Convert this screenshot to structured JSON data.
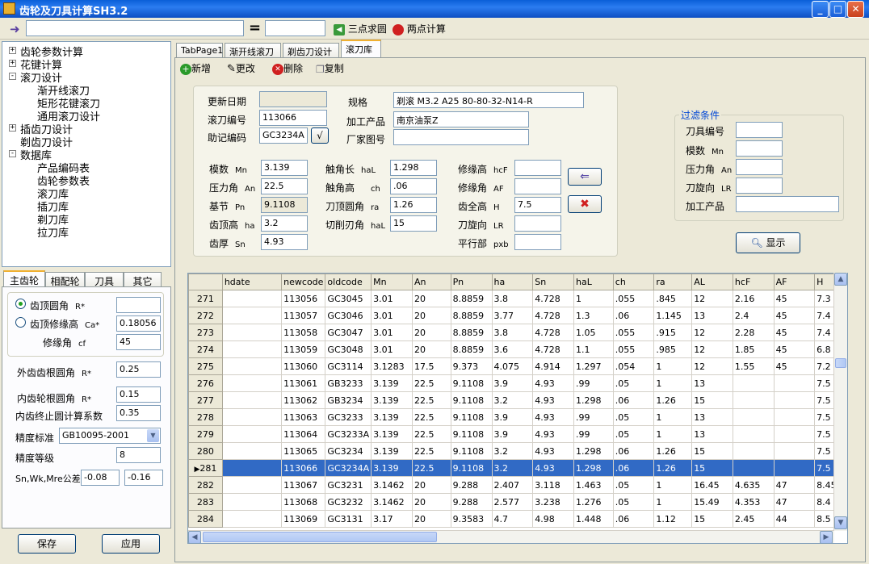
{
  "window": {
    "title": "齿轮及刀具计算SH3.2",
    "minimize": "_",
    "maximize": "□",
    "close": "✕"
  },
  "toolbar": {
    "equals": "=",
    "three_point": "三点求圆",
    "two_point": "两点计算"
  },
  "tree": {
    "items": [
      {
        "label": "齿轮参数计算",
        "expander": "+"
      },
      {
        "label": "花键计算",
        "expander": "+"
      },
      {
        "label": "滚刀设计",
        "expander": "-"
      },
      {
        "label": "渐开线滚刀"
      },
      {
        "label": "矩形花键滚刀"
      },
      {
        "label": "通用滚刀设计"
      },
      {
        "label": "插齿刀设计",
        "expander": "+"
      },
      {
        "label": "剃齿刀设计"
      },
      {
        "label": "数据库",
        "expander": "-"
      },
      {
        "label": "产品编码表"
      },
      {
        "label": "齿轮参数表"
      },
      {
        "label": "滚刀库"
      },
      {
        "label": "插刀库"
      },
      {
        "label": "剃刀库"
      },
      {
        "label": "拉刀库"
      }
    ]
  },
  "left_tabs": [
    "主齿轮",
    "相配轮",
    "刀具",
    "其它"
  ],
  "left_panel": {
    "tip_radius_label": "齿顶圆角",
    "tip_radius_sym": "R*",
    "tip_radius_value": "",
    "tip_mod_label": "齿顶修缘高",
    "tip_mod_sym": "Ca*",
    "tip_mod_value": "0.18056",
    "mod_angle_label": "修缘角",
    "mod_angle_sym": "cf",
    "mod_angle_value": "45",
    "ext_root_label": "外齿齿根圆角",
    "ext_root_sym": "R*",
    "ext_root_value": "0.25",
    "int_root_label": "内齿轮根圆角",
    "int_root_sym": "R*",
    "int_root_value": "0.15",
    "int_stop_label": "内齿终止圆计算系数",
    "int_stop_value": "0.35",
    "precision_std_label": "精度标准",
    "precision_std_value": "GB10095-2001",
    "precision_grade_label": "精度等级",
    "precision_grade_value": "8",
    "tolerance_label": "Sn,Wk,Mre公差",
    "tol_upper": "-0.08",
    "tol_lower": "-0.16",
    "save": "保存",
    "apply": "应用"
  },
  "main_tabs": [
    "TabPage1",
    "渐开线滚刀",
    "剃齿刀设计",
    "滚刀库"
  ],
  "actions": {
    "add": "新增",
    "edit": "更改",
    "delete": "删除",
    "copy": "复制"
  },
  "form": {
    "update_date_label": "更新日期",
    "update_date": "",
    "hob_code_label": "滚刀编号",
    "hob_code": "113066",
    "mnemonic_label": "助记编码",
    "mnemonic": "GC3234A",
    "check_btn": "√",
    "spec_label": "规格",
    "spec": "剃滚 M3.2 A25 80-80-32-N14-R",
    "product_label": "加工产品",
    "product": "南京油泵Z",
    "factory_label": "厂家图号",
    "factory": "",
    "module_label": "模数",
    "module_sym": "Mn",
    "module": "3.139",
    "pressure_label": "压力角",
    "pressure_sym": "An",
    "pressure": "22.5",
    "pitch_label": "基节",
    "pitch_sym": "Pn",
    "pitch": "9.1108",
    "addendum_label": "齿顶高",
    "addendum_sym": "ha",
    "addendum": "3.2",
    "thickness_label": "齿厚",
    "thickness_sym": "Sn",
    "thickness": "4.93",
    "touch_len_label": "触角长",
    "touch_len_sym": "haL",
    "touch_len": "1.298",
    "touch_h_label": "触角高",
    "touch_h_sym": "ch",
    "touch_h": ".06",
    "tip_r_label": "刀顶圆角",
    "tip_r_sym": "ra",
    "tip_r": "1.26",
    "cut_label": "切削刃角",
    "cut_sym": "haL",
    "cut": "15",
    "mod_h_label": "修缘高",
    "mod_h_sym": "hcF",
    "mod_h": "",
    "mod_a_label": "修缘角",
    "mod_a_sym": "AF",
    "mod_a": "",
    "full_h_label": "齿全高",
    "full_h_sym": "H",
    "full_h": "7.5",
    "rot_label": "刀旋向",
    "rot_sym": "LR",
    "rot": "",
    "flat_label": "平行部",
    "flat_sym": "pxb",
    "flat": ""
  },
  "filter": {
    "title": "过滤条件",
    "tool_no_label": "刀具编号",
    "module_label": "模数",
    "module_sym": "Mn",
    "pressure_label": "压力角",
    "pressure_sym": "An",
    "rot_label": "刀旋向",
    "rot_sym": "LR",
    "product_label": "加工产品",
    "show": "显示"
  },
  "grid": {
    "columns": [
      "hdate",
      "newcode",
      "oldcode",
      "Mn",
      "An",
      "Pn",
      "ha",
      "Sn",
      "haL",
      "ch",
      "ra",
      "AL",
      "hcF",
      "AF",
      "H"
    ],
    "rows": [
      [
        "271",
        "",
        "113056",
        "GC3045",
        "3.01",
        "20",
        "8.8859",
        "3.8",
        "4.728",
        "1",
        ".055",
        ".845",
        "12",
        "2.16",
        "45",
        "7.3"
      ],
      [
        "272",
        "",
        "113057",
        "GC3046",
        "3.01",
        "20",
        "8.8859",
        "3.77",
        "4.728",
        "1.3",
        ".06",
        "1.145",
        "13",
        "2.4",
        "45",
        "7.4"
      ],
      [
        "273",
        "",
        "113058",
        "GC3047",
        "3.01",
        "20",
        "8.8859",
        "3.8",
        "4.728",
        "1.05",
        ".055",
        ".915",
        "12",
        "2.28",
        "45",
        "7.4"
      ],
      [
        "274",
        "",
        "113059",
        "GC3048",
        "3.01",
        "20",
        "8.8859",
        "3.6",
        "4.728",
        "1.1",
        ".055",
        ".985",
        "12",
        "1.85",
        "45",
        "6.8"
      ],
      [
        "275",
        "",
        "113060",
        "GC3114",
        "3.1283",
        "17.5",
        "9.373",
        "4.075",
        "4.914",
        "1.297",
        ".054",
        "1",
        "12",
        "1.55",
        "45",
        "7.2"
      ],
      [
        "276",
        "",
        "113061",
        "GB3233",
        "3.139",
        "22.5",
        "9.1108",
        "3.9",
        "4.93",
        ".99",
        ".05",
        "1",
        "13",
        "",
        "",
        "7.5"
      ],
      [
        "277",
        "",
        "113062",
        "GB3234",
        "3.139",
        "22.5",
        "9.1108",
        "3.2",
        "4.93",
        "1.298",
        ".06",
        "1.26",
        "15",
        "",
        "",
        "7.5"
      ],
      [
        "278",
        "",
        "113063",
        "GC3233",
        "3.139",
        "22.5",
        "9.1108",
        "3.9",
        "4.93",
        ".99",
        ".05",
        "1",
        "13",
        "",
        "",
        "7.5"
      ],
      [
        "279",
        "",
        "113064",
        "GC3233A",
        "3.139",
        "22.5",
        "9.1108",
        "3.9",
        "4.93",
        ".99",
        ".05",
        "1",
        "13",
        "",
        "",
        "7.5"
      ],
      [
        "280",
        "",
        "113065",
        "GC3234",
        "3.139",
        "22.5",
        "9.1108",
        "3.2",
        "4.93",
        "1.298",
        ".06",
        "1.26",
        "15",
        "",
        "",
        "7.5"
      ],
      [
        "281",
        "",
        "113066",
        "GC3234A",
        "3.139",
        "22.5",
        "9.1108",
        "3.2",
        "4.93",
        "1.298",
        ".06",
        "1.26",
        "15",
        "",
        "",
        "7.5"
      ],
      [
        "282",
        "",
        "113067",
        "GC3231",
        "3.1462",
        "20",
        "9.288",
        "2.407",
        "3.118",
        "1.463",
        ".05",
        "1",
        "16.45",
        "4.635",
        "47",
        "8.45"
      ],
      [
        "283",
        "",
        "113068",
        "GC3232",
        "3.1462",
        "20",
        "9.288",
        "2.577",
        "3.238",
        "1.276",
        ".05",
        "1",
        "15.49",
        "4.353",
        "47",
        "8.4"
      ],
      [
        "284",
        "",
        "113069",
        "GC3131",
        "3.17",
        "20",
        "9.3583",
        "4.7",
        "4.98",
        "1.448",
        ".06",
        "1.12",
        "15",
        "2.45",
        "44",
        "8.5"
      ]
    ],
    "selected_index": 10,
    "current_marker": "▶"
  }
}
